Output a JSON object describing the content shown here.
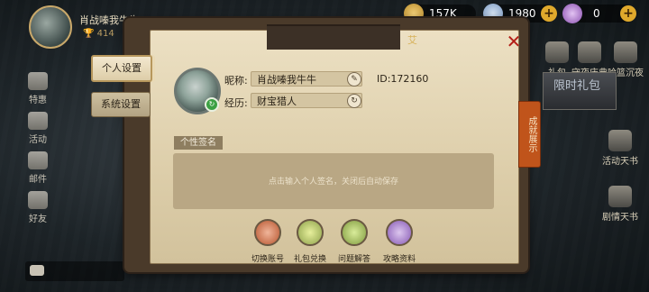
{
  "player": {
    "name": "肖战嗪我牛牛",
    "level": "414"
  },
  "currency": {
    "gold": "157K",
    "diamond": "1980",
    "voucher": "0"
  },
  "side_menu": [
    "特惠",
    "活动",
    "邮件",
    "好友"
  ],
  "right_menu": [
    "礼包",
    "守夜庆典",
    "哈篮沉夜",
    "活动天书",
    "剧情天书"
  ],
  "banner_text": "限时礼包",
  "panel": {
    "header_hint": "艾",
    "tabs": {
      "personal": "个人设置",
      "system": "系统设置"
    },
    "nickname_label": "昵称:",
    "nickname": "肖战嗪我牛牛",
    "id_label": "ID:",
    "id_value": "172160",
    "experience_label": "经历:",
    "experience": "财宝猎人",
    "signature_label": "个性签名",
    "signature_placeholder": "点击输入个人签名，关闭后自动保存",
    "actions": {
      "switch": "切换账号",
      "gift": "礼包兑换",
      "faq": "问题解答",
      "guide": "攻略资料"
    },
    "achievement": "成就展示"
  },
  "colors": {
    "accent": "#c0541b",
    "close": "#b31e17",
    "parchment": "#ece0c3"
  }
}
